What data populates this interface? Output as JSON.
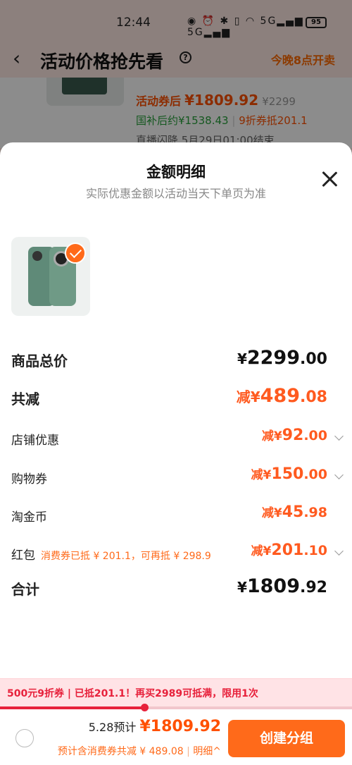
{
  "status_bar": {
    "time": "12:44",
    "battery": "95"
  },
  "nav": {
    "title": "活动价格抢先看",
    "right_text": "今晚8点开卖"
  },
  "background_card": {
    "line1_label": "活动券后",
    "line1_price": "¥1809.92",
    "line1_orig": "¥2299",
    "line2_a": "国补后约¥1538.43",
    "line2_b": "9折券抵201.1",
    "line3": "直播闪降 5月29日01:00结束"
  },
  "sheet": {
    "title": "金额明细",
    "subtitle": "实际优惠金额以活动当天下单页为准",
    "rows": [
      {
        "label": "商品总价",
        "prefix": "",
        "currency": "¥",
        "int": "2299",
        "dec": ".00"
      },
      {
        "label": "共减",
        "prefix": "减",
        "currency": "¥",
        "int": "489",
        "dec": ".08"
      },
      {
        "label": "店铺优惠",
        "prefix": "减",
        "currency": "¥",
        "int": "92",
        "dec": ".00"
      },
      {
        "label": "购物券",
        "prefix": "减",
        "currency": "¥",
        "int": "150",
        "dec": ".00"
      },
      {
        "label": "淘金币",
        "prefix": "减",
        "currency": "¥",
        "int": "45",
        "dec": ".98"
      },
      {
        "label": "红包",
        "note": "消费券已抵 ¥ 201.1，可再抵 ¥ 298.9",
        "prefix": "减",
        "currency": "¥",
        "int": "201",
        "dec": ".10"
      },
      {
        "label": "合计",
        "prefix": "",
        "currency": "¥",
        "int": "1809",
        "dec": ".92"
      }
    ]
  },
  "bottom": {
    "coupon_text": "500元9折券 | 已抵201.1！再买2989可抵满，限用1次",
    "coupon_progress": 0.41,
    "price_prefix": "5.28预计",
    "price_value": "¥1809.92",
    "sum_text": "预计含消费券共减 ¥ 489.08",
    "detail_link": "明细^",
    "create_button": "创建分组"
  },
  "colors": {
    "accent": "#ff6a1a",
    "price": "#ff5000",
    "coupon": "#e7213b",
    "green": "#27a03b"
  }
}
